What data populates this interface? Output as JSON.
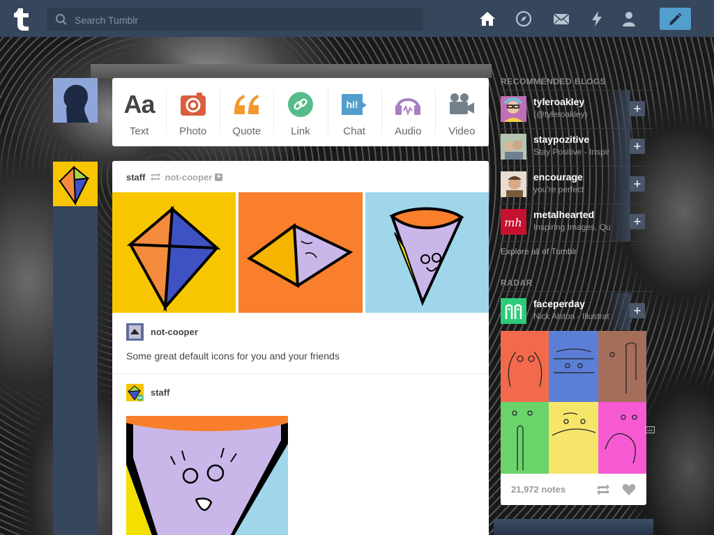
{
  "header": {
    "search_placeholder": "Search Tumblr",
    "nav": [
      "home-icon",
      "explore-compass-icon",
      "inbox-mail-icon",
      "activity-lightning-icon",
      "account-person-icon"
    ],
    "compose_icon": "pencil-icon"
  },
  "post_types": [
    {
      "label": "Text",
      "icon": "text-aa-icon",
      "color": "#444444"
    },
    {
      "label": "Photo",
      "icon": "camera-icon",
      "color": "#d95e40"
    },
    {
      "label": "Quote",
      "icon": "quote-icon",
      "color": "#f2992e"
    },
    {
      "label": "Link",
      "icon": "link-icon",
      "color": "#56bc8a"
    },
    {
      "label": "Chat",
      "icon": "chat-bubble-icon",
      "color": "#529ecc"
    },
    {
      "label": "Audio",
      "icon": "headphones-icon",
      "color": "#a77dc2"
    },
    {
      "label": "Video",
      "icon": "video-camera-icon",
      "color": "#748089"
    }
  ],
  "post": {
    "blog": "staff",
    "reblogged_from": "not-cooper",
    "trail": [
      {
        "name": "not-cooper",
        "text": "Some great default icons for you and your friends"
      },
      {
        "name": "staff"
      }
    ]
  },
  "sidebar": {
    "recommended_title": "RECOMMENDED BLOGS",
    "recommended": [
      {
        "name": "tyleroakley",
        "desc": "(@tyleroakley)"
      },
      {
        "name": "staypozitive",
        "desc": "Stay Positive - Inspir"
      },
      {
        "name": "encourage",
        "desc": "you're perfect"
      },
      {
        "name": "metalhearted",
        "desc": "Inspiring Images, Qu"
      }
    ],
    "explore": "Explore all of Tumblr",
    "radar_title": "RADAR",
    "radar": {
      "name": "faceperday",
      "desc": "Nick Alston - Illustrat",
      "notes": "21,972 notes"
    }
  },
  "colors": {
    "header": "#36465d",
    "compose": "#529ecc"
  }
}
